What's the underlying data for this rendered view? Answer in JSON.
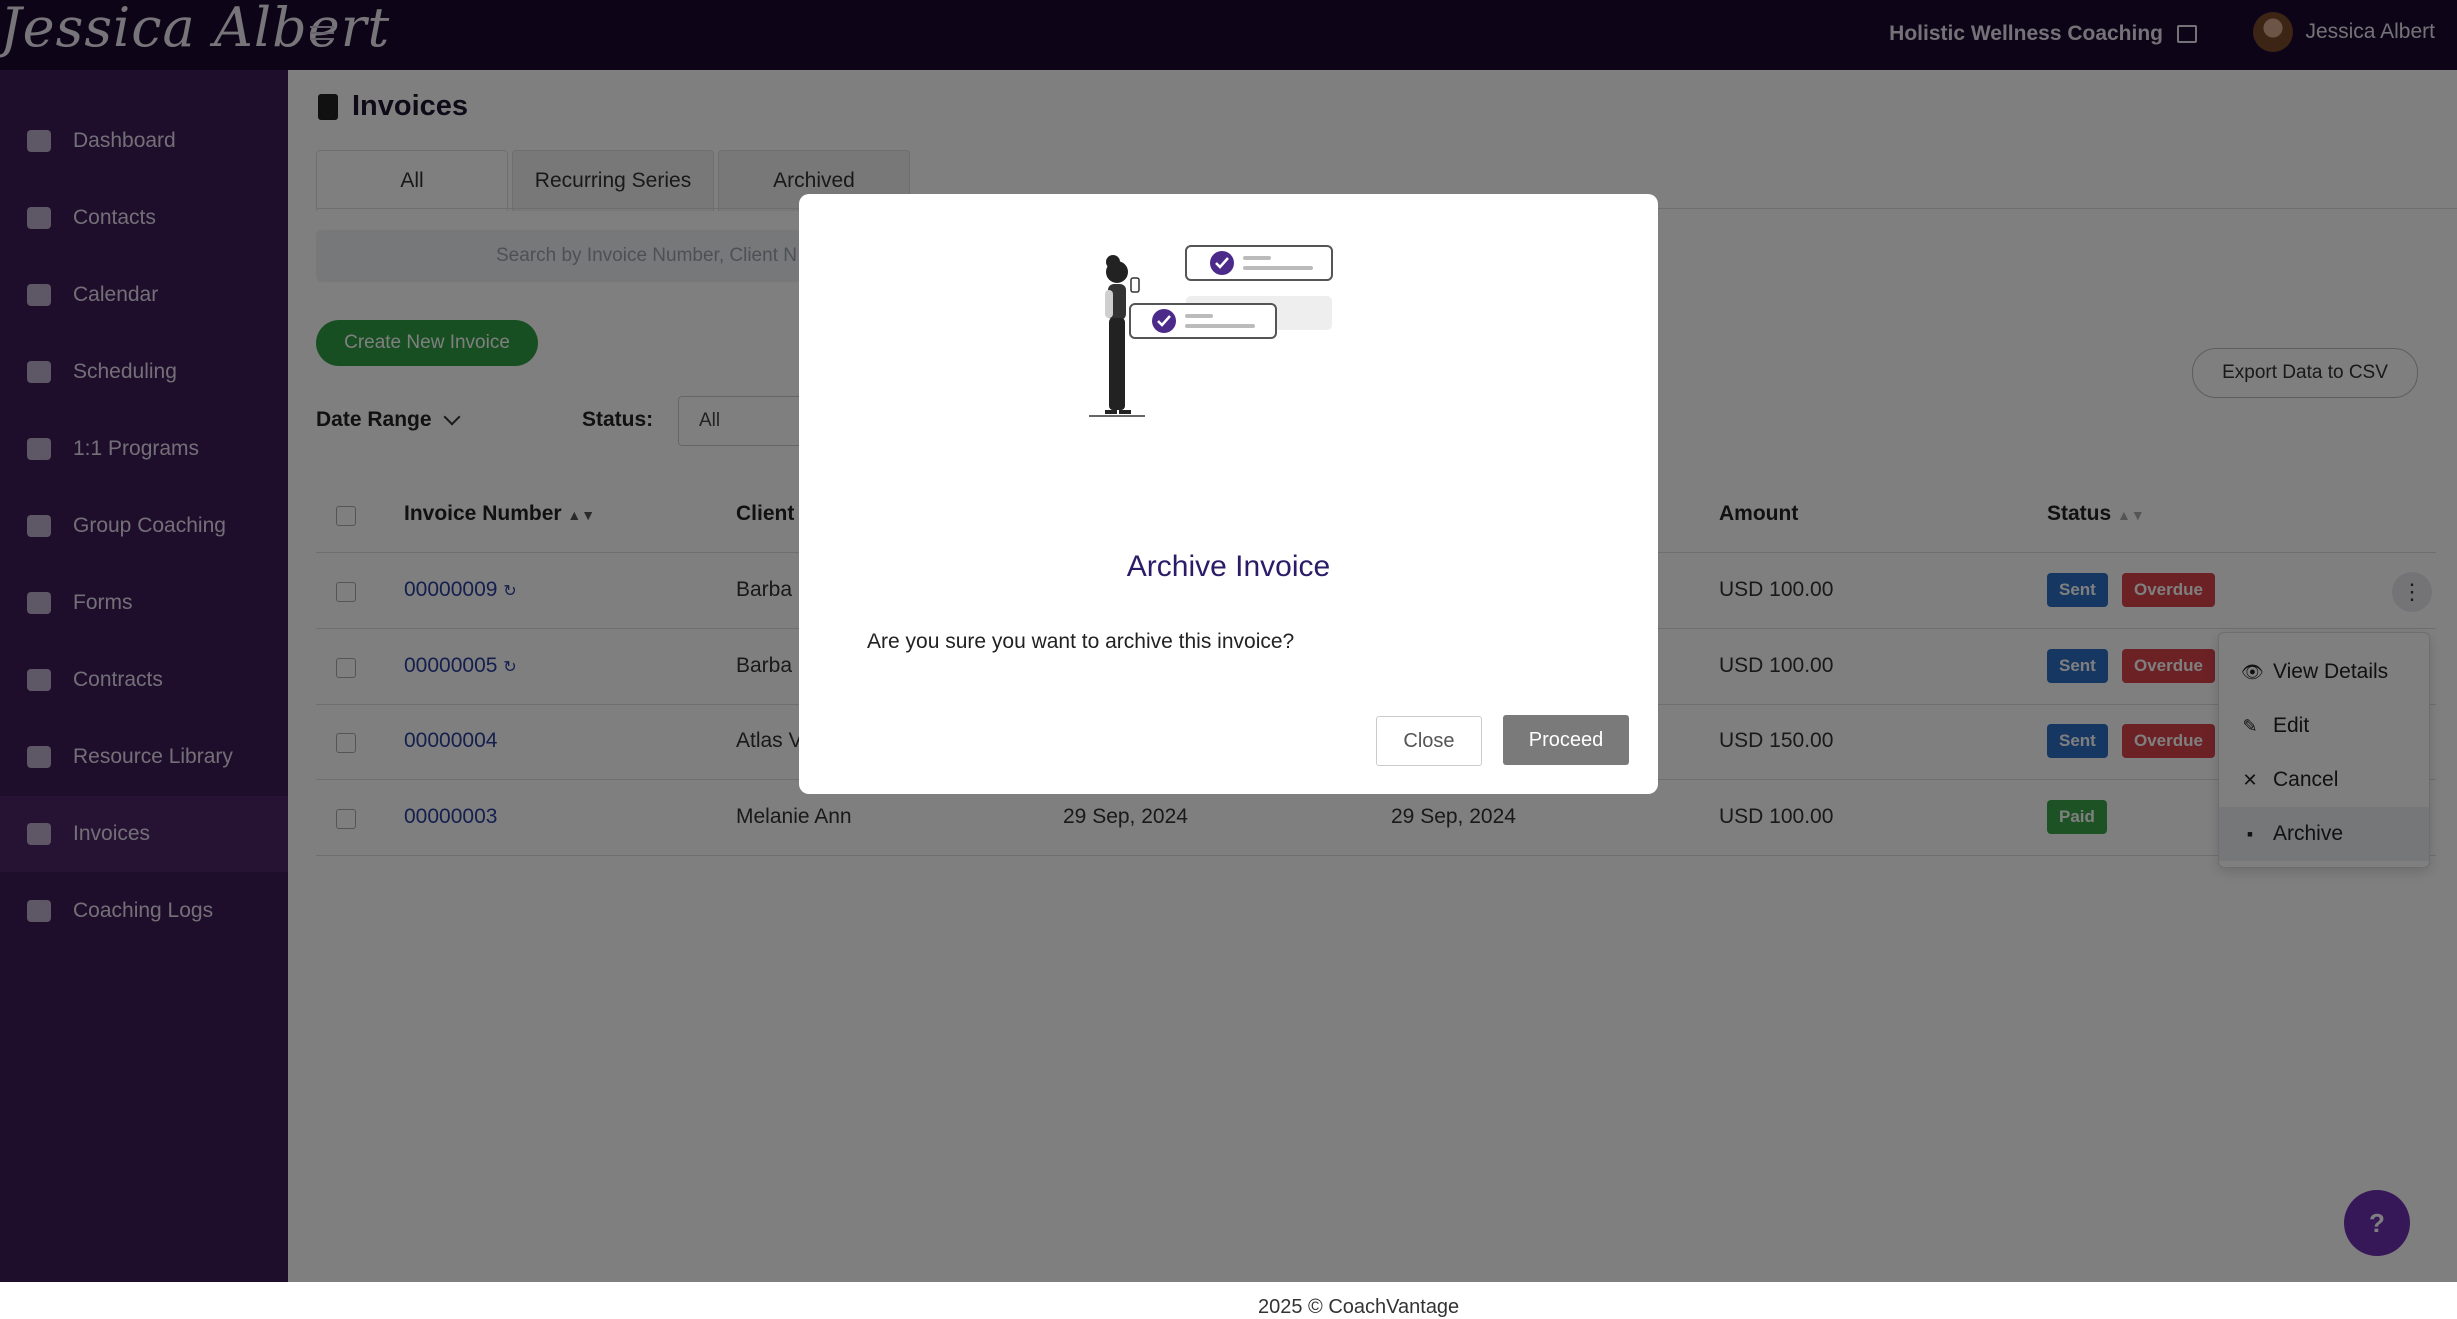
{
  "header": {
    "logo_text": "Jessica Albert",
    "company": "Holistic Wellness Coaching",
    "user_name": "Jessica Albert"
  },
  "sidebar": {
    "items": [
      {
        "label": "Dashboard",
        "icon": "dashboard-icon"
      },
      {
        "label": "Contacts",
        "icon": "contacts-icon"
      },
      {
        "label": "Calendar",
        "icon": "calendar-icon"
      },
      {
        "label": "Scheduling",
        "icon": "scheduling-icon"
      },
      {
        "label": "1:1 Programs",
        "icon": "book-icon"
      },
      {
        "label": "Group Coaching",
        "icon": "group-icon"
      },
      {
        "label": "Forms",
        "icon": "forms-icon"
      },
      {
        "label": "Contracts",
        "icon": "contract-icon"
      },
      {
        "label": "Resource Library",
        "icon": "library-icon"
      },
      {
        "label": "Invoices",
        "icon": "invoice-icon",
        "active": true
      },
      {
        "label": "Coaching Logs",
        "icon": "clock-icon"
      }
    ]
  },
  "main": {
    "title": "Invoices",
    "tabs": [
      {
        "label": "All",
        "active": true
      },
      {
        "label": "Recurring Series"
      },
      {
        "label": "Archived"
      }
    ],
    "search_placeholder": "Search by Invoice Number, Client N",
    "create_button": "Create New Invoice",
    "export_button": "Export Data to CSV",
    "filters": {
      "date_range_label": "Date Range",
      "status_label": "Status:",
      "status_value": "All"
    },
    "table": {
      "headers": [
        "Invoice Number",
        "Client",
        "Amount",
        "Status"
      ],
      "rows": [
        {
          "number": "00000009",
          "client": "Barba",
          "issue": "",
          "due": "",
          "amount": "USD 100.00",
          "badges": [
            "Sent",
            "Overdue"
          ]
        },
        {
          "number": "00000005",
          "client": "Barba",
          "issue": "",
          "due": "",
          "amount": "USD 100.00",
          "badges": [
            "Sent",
            "Overdue"
          ]
        },
        {
          "number": "00000004",
          "client": "Atlas V",
          "issue": "",
          "due": "",
          "amount": "USD 150.00",
          "badges": [
            "Sent",
            "Overdue"
          ]
        },
        {
          "number": "00000003",
          "client": "Melanie Ann",
          "issue": "29 Sep, 2024",
          "due": "29 Sep, 2024",
          "amount": "USD 100.00",
          "badges": [
            "Paid"
          ]
        }
      ]
    },
    "row_menu": {
      "items": [
        {
          "label": "View Details",
          "icon": "eye-icon"
        },
        {
          "label": "Edit",
          "icon": "pencil-icon"
        },
        {
          "label": "Cancel",
          "icon": "x-icon"
        },
        {
          "label": "Archive",
          "icon": "archive-icon"
        }
      ]
    },
    "footer": "2025 © CoachVantage",
    "help": "?"
  },
  "modal": {
    "title": "Archive Invoice",
    "message": "Are you sure you want to archive this invoice?",
    "close_label": "Close",
    "proceed_label": "Proceed"
  },
  "colors": {
    "topbar": "#1b0a2e",
    "sidebar": "#3d1a56",
    "create_button": "#2f9e44",
    "sent": "#2f6fc7",
    "overdue": "#d9424a",
    "paid": "#3aa54a",
    "modal_title": "#2c1b66",
    "help_button": "#6c2fb0"
  }
}
